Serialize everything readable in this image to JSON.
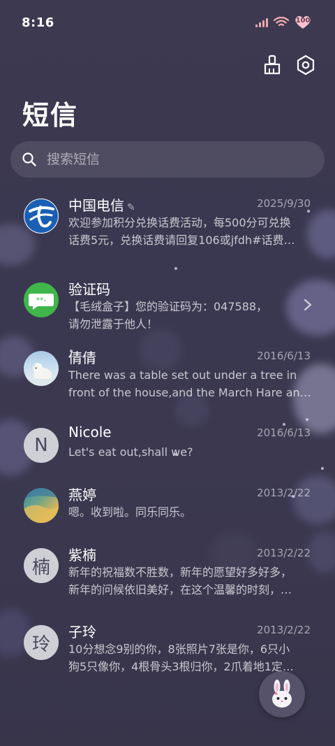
{
  "status_bar": {
    "time": "8:16",
    "battery": "100"
  },
  "header": {
    "title": "短信"
  },
  "search": {
    "placeholder": "搜索短信"
  },
  "messages": [
    {
      "name": "中国电信",
      "date": "2025/9/30",
      "line1": "欢迎参加积分兑换话费活动，每500分可兑换",
      "line2": "话费5元，兑换话费请回复106或jfdh#话费…",
      "avatar": "china-telecom-logo"
    },
    {
      "name": "验证码",
      "date": "",
      "line1": "【毛绒盒子】您的验证码为：047588，",
      "line2": "请勿泄露于他人！",
      "avatar": "chat-bubble-icon",
      "avatar_text": "**-"
    },
    {
      "name": "倩倩",
      "date": "2016/6/13",
      "line1": "There was a table set out under a tree in",
      "line2": "front of the house,and the March Hare an…",
      "avatar": "polar-bear-photo"
    },
    {
      "name": "Nicole",
      "date": "2016/6/13",
      "line1": "Let's eat out,shall we?",
      "line2": "",
      "avatar": "letter",
      "avatar_text": "N"
    },
    {
      "name": "燕婷",
      "date": "2013/2/22",
      "line1": "嗯。收到啦。同乐同乐。",
      "line2": "",
      "avatar": "landscape-photo"
    },
    {
      "name": "紫楠",
      "date": "2013/2/22",
      "line1": "新年的祝福数不胜数，新年的愿望好多好多，",
      "line2": "新年的问候依旧美好，在这个温馨的时刻，…",
      "avatar": "letter",
      "avatar_text": "楠"
    },
    {
      "name": "子玲",
      "date": "2013/2/22",
      "line1": "10分想念9别的你，8张照片7张是你，6只小",
      "line2": "狗5只像你，4根骨头3根归你，2爪着地1定…",
      "avatar": "letter",
      "avatar_text": "玲"
    }
  ],
  "colors": {
    "background": "#3b3850",
    "accent_green": "#3fb54a",
    "telecom_blue": "#1a5fb4"
  }
}
